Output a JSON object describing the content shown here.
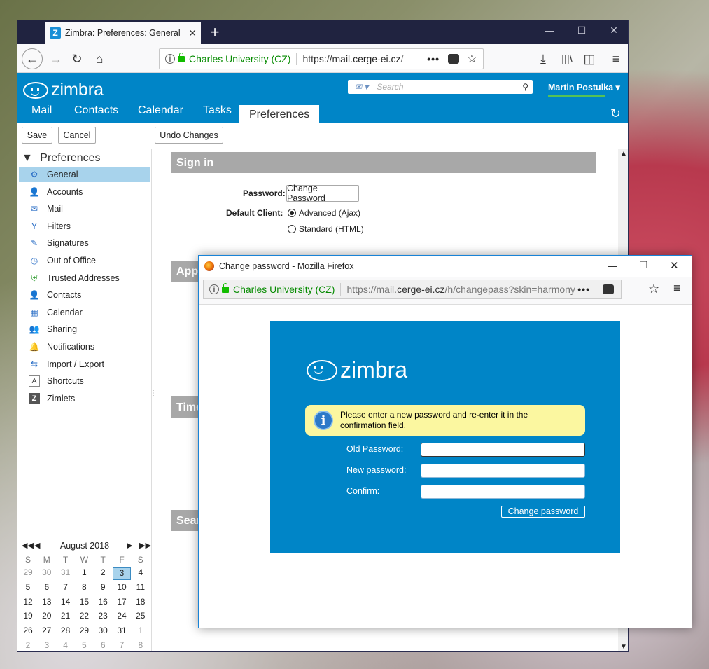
{
  "browser": {
    "tab_title": "Zimbra: Preferences: General",
    "tab_favicon": "Z",
    "url_identity": "Charles University (CZ)",
    "url_prefix": "https://mail.",
    "url_domain": "cerge-ei.cz",
    "url_suffix": "/",
    "more": "•••"
  },
  "zimbra": {
    "logo_text": "zimbra",
    "search_placeholder": "Search",
    "user": "Martin Postulka",
    "tabs": [
      {
        "label": "Mail"
      },
      {
        "label": "Contacts"
      },
      {
        "label": "Calendar"
      },
      {
        "label": "Tasks"
      },
      {
        "label": "Preferences"
      }
    ]
  },
  "toolbar": {
    "save": "Save",
    "cancel": "Cancel",
    "undo": "Undo Changes"
  },
  "sidebar": {
    "title": "Preferences",
    "items": [
      {
        "label": "General",
        "icon": "gear-icon"
      },
      {
        "label": "Accounts",
        "icon": "accounts-icon"
      },
      {
        "label": "Mail",
        "icon": "mail-icon"
      },
      {
        "label": "Filters",
        "icon": "filter-icon"
      },
      {
        "label": "Signatures",
        "icon": "signature-icon"
      },
      {
        "label": "Out of Office",
        "icon": "out-of-office-icon"
      },
      {
        "label": "Trusted Addresses",
        "icon": "shield-check-icon"
      },
      {
        "label": "Contacts",
        "icon": "contacts-icon"
      },
      {
        "label": "Calendar",
        "icon": "calendar-icon"
      },
      {
        "label": "Sharing",
        "icon": "sharing-icon"
      },
      {
        "label": "Notifications",
        "icon": "bell-icon"
      },
      {
        "label": "Import / Export",
        "icon": "import-export-icon"
      },
      {
        "label": "Shortcuts",
        "icon": "keyboard-icon"
      },
      {
        "label": "Zimlets",
        "icon": "zimlet-icon"
      }
    ]
  },
  "minical": {
    "month": "August 2018",
    "days": [
      "S",
      "M",
      "T",
      "W",
      "T",
      "F",
      "S"
    ],
    "weeks": [
      [
        "29",
        "30",
        "31",
        "1",
        "2",
        "3",
        "4"
      ],
      [
        "5",
        "6",
        "7",
        "8",
        "9",
        "10",
        "11"
      ],
      [
        "12",
        "13",
        "14",
        "15",
        "16",
        "17",
        "18"
      ],
      [
        "19",
        "20",
        "21",
        "22",
        "23",
        "24",
        "25"
      ],
      [
        "26",
        "27",
        "28",
        "29",
        "30",
        "31",
        "1"
      ],
      [
        "2",
        "3",
        "4",
        "5",
        "6",
        "7",
        "8"
      ]
    ],
    "selected": "3"
  },
  "content": {
    "section_signin": "Sign in",
    "password_label": "Password:",
    "change_password_btn": "Change Password",
    "default_client_label": "Default Client:",
    "opt_advanced": "Advanced (Ajax)",
    "opt_standard": "Standard (HTML)",
    "sec_app": "App",
    "sec_time": "Time",
    "sec_search": "Sear"
  },
  "popup": {
    "title": "Change password - Mozilla Firefox",
    "identity": "Charles University (CZ)",
    "url_prefix": "https://mail.",
    "url_domain": "cerge-ei.cz",
    "url_suffix": "/h/changepass?skin=harmony",
    "more": "•••",
    "logo_text": "zimbra",
    "info_line1": "Please enter a new password and re-enter it in the",
    "info_line2": "confirmation field.",
    "old_password_label": "Old Password:",
    "new_password_label": "New password:",
    "confirm_label": "Confirm:",
    "submit": "Change password"
  }
}
